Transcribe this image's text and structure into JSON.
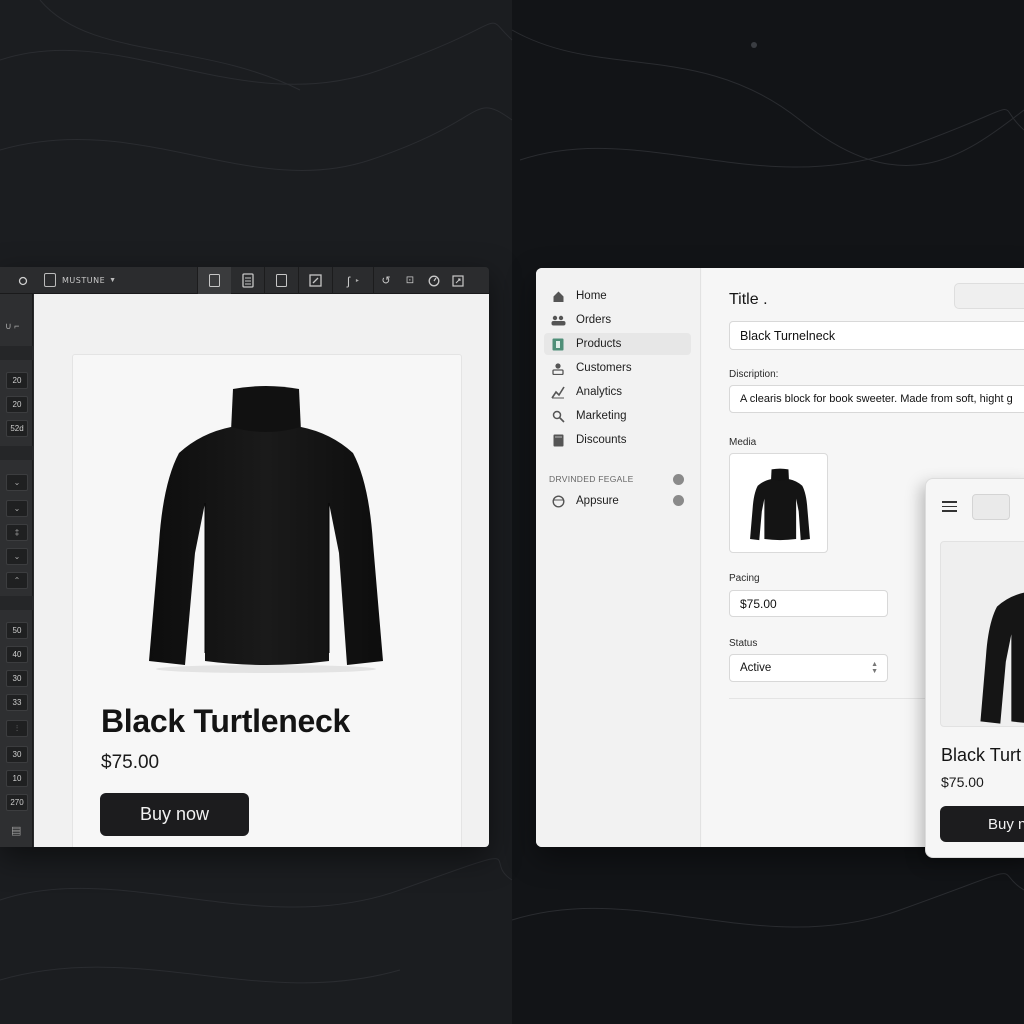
{
  "editor": {
    "toolbar": {
      "file_name": "MUSTUNE",
      "left_mini_label": "ꜛ∞"
    },
    "sidebar_values": [
      "20",
      "20",
      "52d",
      "50",
      "40",
      "30",
      "33",
      "30",
      "10",
      "270"
    ],
    "card": {
      "title": "Black Turtleneck",
      "price": "$75.00",
      "buy_label": "Buy now"
    }
  },
  "admin": {
    "nav": {
      "items": [
        {
          "label": "Home",
          "icon": "home-icon"
        },
        {
          "label": "Orders",
          "icon": "users-icon"
        },
        {
          "label": "Products",
          "icon": "product-tag-icon"
        },
        {
          "label": "Customers",
          "icon": "customer-icon"
        },
        {
          "label": "Analytics",
          "icon": "analytics-icon"
        },
        {
          "label": "Marketing",
          "icon": "marketing-icon"
        },
        {
          "label": "Discounts",
          "icon": "discount-icon"
        }
      ],
      "section_label": "DRVINDED FEGALE",
      "section_items": [
        {
          "label": "Appsure",
          "icon": "app-icon"
        }
      ]
    },
    "form": {
      "title_heading": "Title .",
      "title_value": "Black Turnelneck",
      "description_label": "Discription:",
      "description_value": "A clearis block for book sweeter. Made from soft, hight g",
      "media_label": "Media",
      "pricing_label": "Pacing",
      "pricing_value": "$75.00",
      "status_label": "Status",
      "status_value": "Active"
    }
  },
  "preview": {
    "title": "Black Turt",
    "price": "$75.00",
    "buy_label": "Buy n"
  },
  "colors": {
    "button_dark": "#1c1c1e",
    "active_nav": "#e7e7e7",
    "products_icon": "#4f8f78"
  }
}
